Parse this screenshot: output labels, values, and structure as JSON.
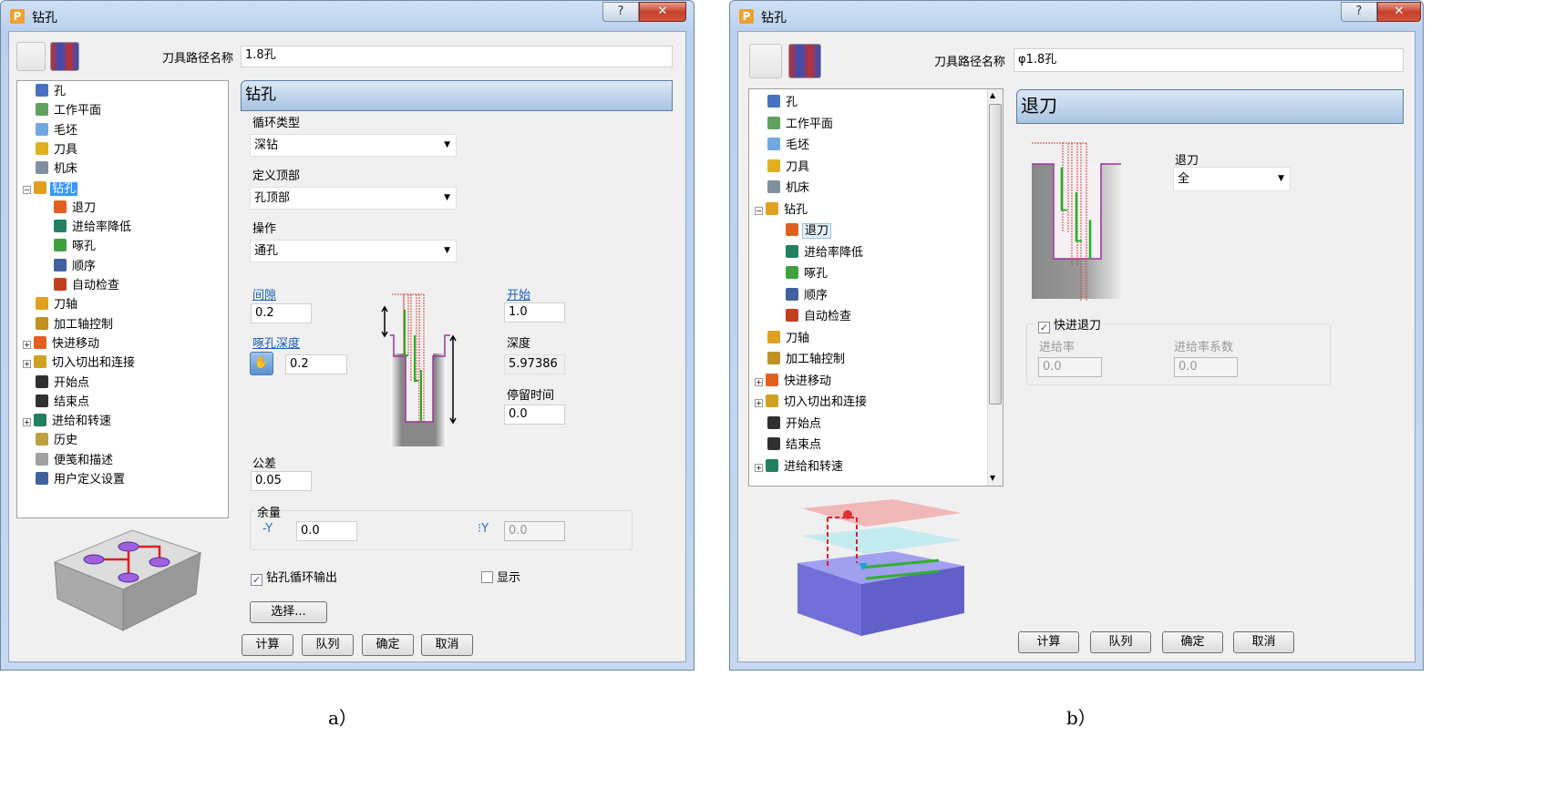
{
  "panel_a": {
    "window_title": "钻孔",
    "help_label": "?",
    "close_label": "✕",
    "toolpath_name_label": "刀具路径名称",
    "toolpath_name_value": "1.8孔",
    "section_title": "钻孔",
    "cycle_type_label": "循环类型",
    "cycle_type_value": "深钻",
    "define_top_label": "定义顶部",
    "define_top_value": "孔顶部",
    "operation_label": "操作",
    "operation_value": "通孔",
    "clearance_label": "间隙",
    "clearance_value": "0.2",
    "peck_depth_label": "啄孔深度",
    "peck_depth_value": "0.2",
    "start_label": "开始",
    "start_value": "1.0",
    "depth_label": "深度",
    "depth_value": "5.97386",
    "dwell_label": "停留时间",
    "dwell_value": "0.0",
    "tolerance_label": "公差",
    "tolerance_value": "0.05",
    "allowance_label": "余量",
    "allowance_value": "0.0",
    "allowance2_value": "0.0",
    "drill_cycle_output_label": "钻孔循环输出",
    "drill_cycle_output_checked": true,
    "display_label": "显示",
    "display_checked": false,
    "select_button": "选择...",
    "buttons": [
      "计算",
      "队列",
      "确定",
      "取消"
    ],
    "tree": [
      {
        "label": "孔",
        "icon": "hole-icon",
        "level": 1,
        "color": "#4a70c0"
      },
      {
        "label": "工作平面",
        "icon": "workplane-icon",
        "level": 1,
        "color": "#60a060"
      },
      {
        "label": "毛坯",
        "icon": "block-icon",
        "level": 1,
        "color": "#70a8e0"
      },
      {
        "label": "刀具",
        "icon": "tool-icon",
        "level": 1,
        "color": "#e0b020"
      },
      {
        "label": "机床",
        "icon": "machine-icon",
        "level": 1,
        "color": "#8090a0"
      },
      {
        "label": "钻孔",
        "icon": "drilling-icon",
        "level": 1,
        "color": "#e0a020",
        "expander": "−",
        "selected": true
      },
      {
        "label": "退刀",
        "icon": "retract-icon",
        "level": 2,
        "color": "#e06020"
      },
      {
        "label": "进给率降低",
        "icon": "feed-reduction-icon",
        "level": 2,
        "color": "#208060"
      },
      {
        "label": "啄孔",
        "icon": "peck-icon",
        "level": 2,
        "color": "#40a040"
      },
      {
        "label": "顺序",
        "icon": "order-icon",
        "level": 2,
        "color": "#4060a0"
      },
      {
        "label": "自动检查",
        "icon": "auto-verify-icon",
        "level": 2,
        "color": "#c04020"
      },
      {
        "label": "刀轴",
        "icon": "tool-axis-icon",
        "level": 1,
        "color": "#e0a020"
      },
      {
        "label": "加工轴控制",
        "icon": "axis-control-icon",
        "level": 1,
        "color": "#c09020"
      },
      {
        "label": "快进移动",
        "icon": "rapid-move-icon",
        "level": 1,
        "color": "#e06020",
        "expander": "+"
      },
      {
        "label": "切入切出和连接",
        "icon": "leads-links-icon",
        "level": 1,
        "color": "#d0a020",
        "expander": "+"
      },
      {
        "label": "开始点",
        "icon": "start-point-icon",
        "level": 1,
        "color": "#303030"
      },
      {
        "label": "结束点",
        "icon": "end-point-icon",
        "level": 1,
        "color": "#303030"
      },
      {
        "label": "进给和转速",
        "icon": "feeds-speeds-icon",
        "level": 1,
        "color": "#208060",
        "expander": "+"
      },
      {
        "label": "历史",
        "icon": "history-icon",
        "level": 1,
        "color": "#c0a040"
      },
      {
        "label": "便笺和描述",
        "icon": "notes-icon",
        "level": 1,
        "color": "#a0a0a0"
      },
      {
        "label": "用户定义设置",
        "icon": "user-settings-icon",
        "level": 1,
        "color": "#4060a0"
      }
    ],
    "caption": "a）"
  },
  "panel_b": {
    "window_title": "钻孔",
    "help_label": "?",
    "close_label": "✕",
    "toolpath_name_label": "刀具路径名称",
    "toolpath_name_value": "φ1.8孔",
    "section_title": "退刀",
    "retract_label": "退刀",
    "retract_value": "全",
    "rapid_retract_label": "快进退刀",
    "rapid_retract_checked": true,
    "feed_rate_label": "进给率",
    "feed_rate_value": "0.0",
    "feed_factor_label": "进给率系数",
    "feed_factor_value": "0.0",
    "buttons": [
      "计算",
      "队列",
      "确定",
      "取消"
    ],
    "tree": [
      {
        "label": "孔",
        "icon": "hole-icon",
        "level": 1,
        "color": "#4a70c0"
      },
      {
        "label": "工作平面",
        "icon": "workplane-icon",
        "level": 1,
        "color": "#60a060"
      },
      {
        "label": "毛坯",
        "icon": "block-icon",
        "level": 1,
        "color": "#70a8e0"
      },
      {
        "label": "刀具",
        "icon": "tool-icon",
        "level": 1,
        "color": "#e0b020"
      },
      {
        "label": "机床",
        "icon": "machine-icon",
        "level": 1,
        "color": "#8090a0"
      },
      {
        "label": "钻孔",
        "icon": "drilling-icon",
        "level": 1,
        "color": "#e0a020",
        "expander": "−"
      },
      {
        "label": "退刀",
        "icon": "retract-icon",
        "level": 2,
        "color": "#e06020",
        "selected": true
      },
      {
        "label": "进给率降低",
        "icon": "feed-reduction-icon",
        "level": 2,
        "color": "#208060"
      },
      {
        "label": "啄孔",
        "icon": "peck-icon",
        "level": 2,
        "color": "#40a040"
      },
      {
        "label": "顺序",
        "icon": "order-icon",
        "level": 2,
        "color": "#4060a0"
      },
      {
        "label": "自动检查",
        "icon": "auto-verify-icon",
        "level": 2,
        "color": "#c04020"
      },
      {
        "label": "刀轴",
        "icon": "tool-axis-icon",
        "level": 1,
        "color": "#e0a020"
      },
      {
        "label": "加工轴控制",
        "icon": "axis-control-icon",
        "level": 1,
        "color": "#c09020"
      },
      {
        "label": "快进移动",
        "icon": "rapid-move-icon",
        "level": 1,
        "color": "#e06020",
        "expander": "+"
      },
      {
        "label": "切入切出和连接",
        "icon": "leads-links-icon",
        "level": 1,
        "color": "#d0a020",
        "expander": "+"
      },
      {
        "label": "开始点",
        "icon": "start-point-icon",
        "level": 1,
        "color": "#303030"
      },
      {
        "label": "结束点",
        "icon": "end-point-icon",
        "level": 1,
        "color": "#303030"
      },
      {
        "label": "进给和转速",
        "icon": "feeds-speeds-icon",
        "level": 1,
        "color": "#208060",
        "expander": "+"
      }
    ],
    "caption": "b）"
  }
}
